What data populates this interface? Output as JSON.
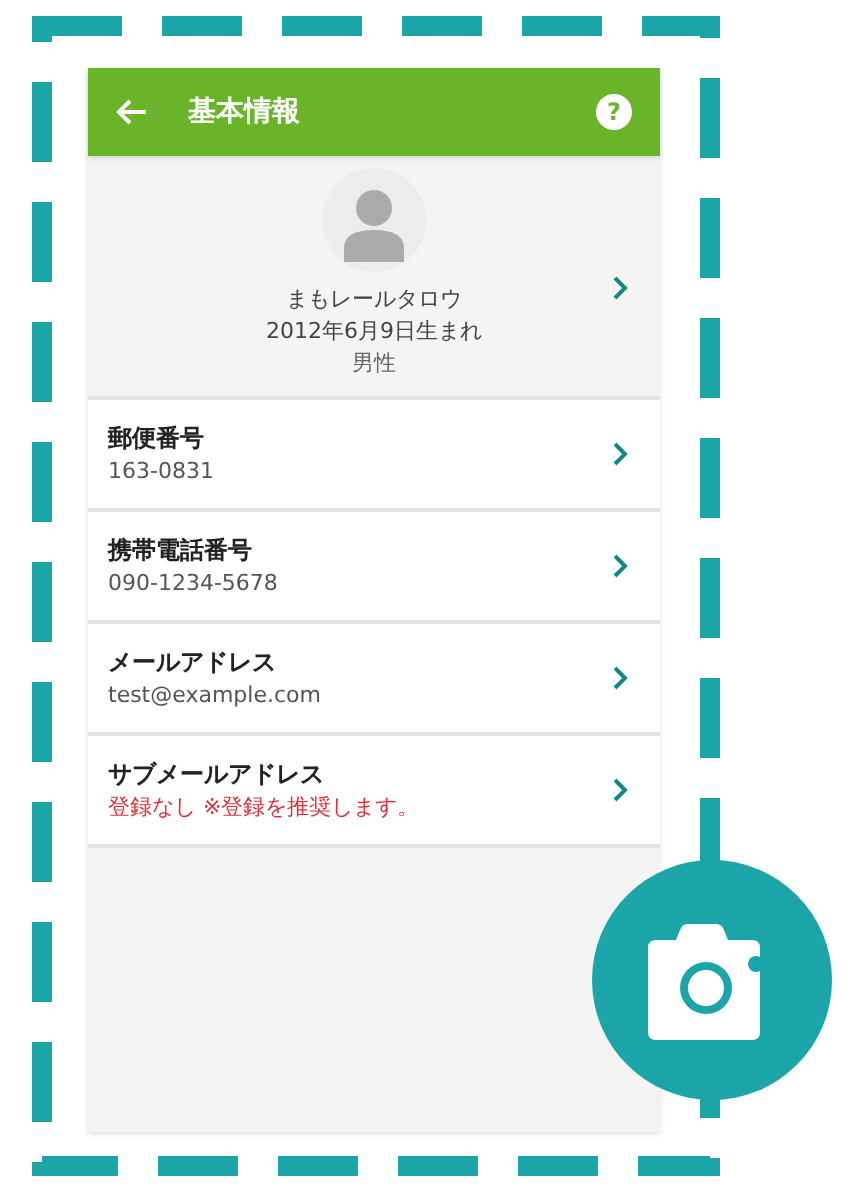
{
  "header": {
    "title": "基本情報",
    "help": "?"
  },
  "profile": {
    "name": "まもレールタロウ",
    "birthday": "2012年6月9日生まれ",
    "gender": "男性"
  },
  "rows": [
    {
      "label": "郵便番号",
      "value": "163-0831",
      "kind": "normal"
    },
    {
      "label": "携帯電話番号",
      "value": "090-1234-5678",
      "kind": "normal"
    },
    {
      "label": "メールアドレス",
      "value": "test@example.com",
      "kind": "normal"
    },
    {
      "label": "サブメールアドレス",
      "value": "登録なし ※登録を推奨します。",
      "kind": "warning"
    }
  ]
}
